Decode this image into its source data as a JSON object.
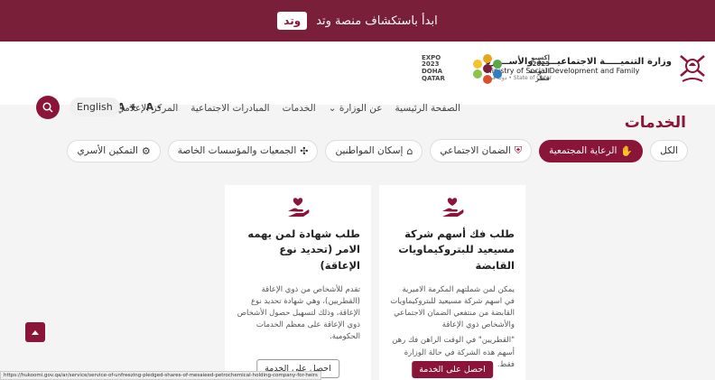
{
  "banner": {
    "text": "ابدأ باستكشاف منصة وتد",
    "logo": "وتد"
  },
  "header": {
    "ministry": {
      "ar": "وزارة التنميـــــة الاجتماعيـــــة والأســــرة",
      "en": "Ministry of Social Development and Family",
      "sub": "State of Qatar • دولة قطر"
    },
    "expo": {
      "left": "EXPO\n2023\nDOHA\nQATAR",
      "right": "إكسبو\n2023\nالدوحة\nقطر"
    },
    "nav": [
      "الصفحة الرئيسية",
      "عن الوزارة ⌄",
      "الخدمات",
      "المبادرات الاجتماعية",
      "المركز الإعلامي"
    ],
    "font_plus": "A +",
    "font_minus": "A -",
    "language": "English"
  },
  "page_title": "الخدمات",
  "tabs": [
    {
      "label": "الكل",
      "active": false,
      "icon": ""
    },
    {
      "label": "الرعاية المجتمعية",
      "active": true,
      "icon": "hand-heart-icon"
    },
    {
      "label": "الضمان الاجتماعي",
      "active": false,
      "icon": "shield-icon"
    },
    {
      "label": "إسكان المواطنين",
      "active": false,
      "icon": "housing-icon"
    },
    {
      "label": "الجمعيات والمؤسسات الخاصة",
      "active": false,
      "icon": "network-icon"
    },
    {
      "label": "التمكين الأسري",
      "active": false,
      "icon": "gear-icon"
    }
  ],
  "cards": [
    {
      "title": "طلب فك أسهم شركة مسيعيد للبتروكيماويات القابضة",
      "description": "يمكن لمن شملتهم المكرمة الاميرية في اسهم شركة مسيعيد للبتروكيماويات القابضة من منتفعي الضمان الاجتماعي والأشخاص ذوي الإعاقة",
      "note": "\"القطريين\" في الوقت الراهن فك رهن أسهم هذه الشركة في حالة الوزارة فقط.",
      "button": "احصل على الخدمة"
    },
    {
      "title": "طلب شهادة لمن يهمه الامر (تحديد نوع الإعاقة)",
      "description": "تقدم للأشخاص من ذوي الإعاقة (القطريين)، وهي شهادة تحديد نوع الإعاقة، وذلك لتسهيل حصول الأشخاص ذوي الإعاقة على معظم الخدمات الحكومية.",
      "button": "احصل على الخدمة"
    }
  ],
  "status_url": "https://hukoomi.gov.qa/ar/service/service-of-unfreezing-pledged-shares-of-mesaieed-petrochemical-holding-company-for-heirs",
  "colors": {
    "brand": "#8a1538",
    "banner": "#7a1f3a"
  }
}
